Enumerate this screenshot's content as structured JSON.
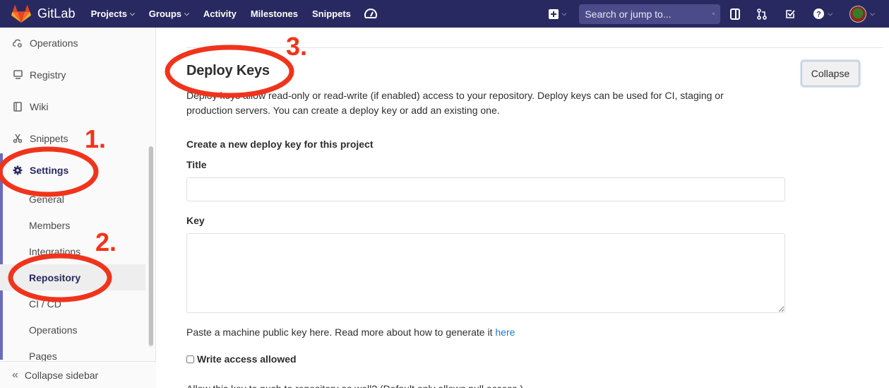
{
  "brand": {
    "name": "GitLab"
  },
  "nav": {
    "links": [
      {
        "label": "Projects",
        "dropdown": true
      },
      {
        "label": "Groups",
        "dropdown": true
      },
      {
        "label": "Activity",
        "dropdown": false
      },
      {
        "label": "Milestones",
        "dropdown": false
      },
      {
        "label": "Snippets",
        "dropdown": false
      }
    ],
    "search_placeholder": "Search or jump to..."
  },
  "sidebar": {
    "items": [
      {
        "label": "Operations",
        "icon": "cloud-gear-icon"
      },
      {
        "label": "Registry",
        "icon": "monitor-icon"
      },
      {
        "label": "Wiki",
        "icon": "book-icon"
      },
      {
        "label": "Snippets",
        "icon": "scissors-icon"
      },
      {
        "label": "Settings",
        "icon": "gear-icon"
      }
    ],
    "settings_subitems": [
      "General",
      "Members",
      "Integrations",
      "Repository",
      "CI / CD",
      "Operations",
      "Pages"
    ],
    "active_subitem": "Repository",
    "collapse_label": "Collapse sidebar"
  },
  "section": {
    "title": "Deploy Keys",
    "collapse_button": "Collapse",
    "description": "Deploy keys allow read-only or read-write (if enabled) access to your repository. Deploy keys can be used for CI, staging or production servers. You can create a deploy key or add an existing one.",
    "form_heading": "Create a new deploy key for this project",
    "title_label": "Title",
    "title_value": "",
    "key_label": "Key",
    "key_value": "",
    "help_text": "Paste a machine public key here. Read more about how to generate it",
    "help_link": "here",
    "write_access_label": "Write access allowed",
    "write_access_checked": false,
    "next_line": "Allow this key to push to repository as well? (Default only allows pull access.)"
  },
  "annotations": {
    "color": "#f0341c",
    "steps": [
      "1.",
      "2.",
      "3."
    ]
  },
  "colors": {
    "navbar": "#292961",
    "link": "#1f78d1",
    "sidebar_active": "#6b6bbd"
  }
}
